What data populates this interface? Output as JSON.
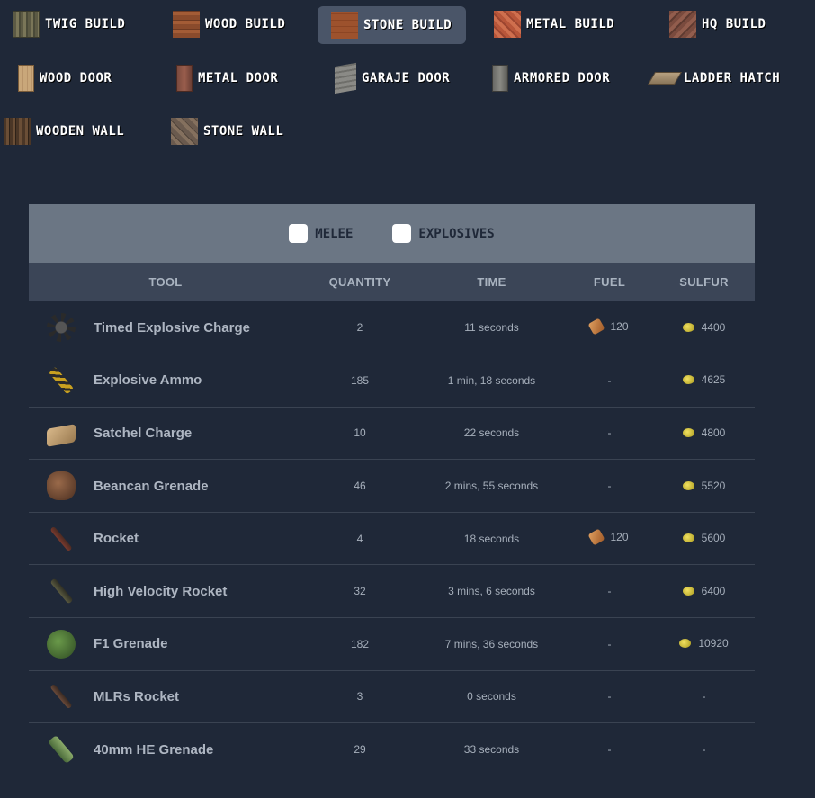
{
  "builds": [
    {
      "label": "Twig Build",
      "texture": "twig",
      "active": false
    },
    {
      "label": "Wood Build",
      "texture": "wood",
      "active": false
    },
    {
      "label": "Stone Build",
      "texture": "stone",
      "active": true
    },
    {
      "label": "Metal Build",
      "texture": "metal",
      "active": false
    },
    {
      "label": "HQ Build",
      "texture": "hq",
      "active": false
    },
    {
      "label": "Wood Door",
      "texture": "wdoor",
      "active": false
    },
    {
      "label": "Metal Door",
      "texture": "mdoor",
      "active": false
    },
    {
      "label": "Garaje Door",
      "texture": "gdoor",
      "active": false
    },
    {
      "label": "Armored Door",
      "texture": "adoor",
      "active": false
    },
    {
      "label": "Ladder Hatch",
      "texture": "hatch",
      "active": false
    },
    {
      "label": "Wooden Wall",
      "texture": "wwall",
      "active": false
    },
    {
      "label": "Stone Wall",
      "texture": "swall",
      "active": false
    }
  ],
  "filters": [
    {
      "label": "Melee",
      "checked": false
    },
    {
      "label": "Explosives",
      "checked": false
    }
  ],
  "table": {
    "headers": [
      "Tool",
      "Quantity",
      "Time",
      "Fuel",
      "Sulfur"
    ],
    "rows": [
      {
        "icon": "timed-explosive-charge-icon",
        "name": "Timed Explosive Charge",
        "quantity": "2",
        "time": "11 seconds",
        "fuel": "120",
        "sulfur": "4400"
      },
      {
        "icon": "explosive-ammo-icon",
        "name": "Explosive Ammo",
        "quantity": "185",
        "time": "1 min, 18 seconds",
        "fuel": "-",
        "sulfur": "4625"
      },
      {
        "icon": "satchel-charge-icon",
        "name": "Satchel Charge",
        "quantity": "10",
        "time": "22 seconds",
        "fuel": "-",
        "sulfur": "4800"
      },
      {
        "icon": "beancan-grenade-icon",
        "name": "Beancan Grenade",
        "quantity": "46",
        "time": "2 mins, 55 seconds",
        "fuel": "-",
        "sulfur": "5520"
      },
      {
        "icon": "rocket-icon",
        "name": "Rocket",
        "quantity": "4",
        "time": "18 seconds",
        "fuel": "120",
        "sulfur": "5600"
      },
      {
        "icon": "high-velocity-rocket-icon",
        "name": "High Velocity Rocket",
        "quantity": "32",
        "time": "3 mins, 6 seconds",
        "fuel": "-",
        "sulfur": "6400"
      },
      {
        "icon": "f1-grenade-icon",
        "name": "F1 Grenade",
        "quantity": "182",
        "time": "7 mins, 36 seconds",
        "fuel": "-",
        "sulfur": "10920"
      },
      {
        "icon": "mlrs-rocket-icon",
        "name": "MLRs Rocket",
        "quantity": "3",
        "time": "0 seconds",
        "fuel": "-",
        "sulfur": "-"
      },
      {
        "icon": "40mm-he-grenade-icon",
        "name": "40mm HE Grenade",
        "quantity": "29",
        "time": "33 seconds",
        "fuel": "-",
        "sulfur": "-"
      }
    ]
  },
  "colors": {
    "background": "#1f2838",
    "active_button": "#4a5568",
    "filter_bar": "#6b7684",
    "table_header": "#3b4557"
  }
}
